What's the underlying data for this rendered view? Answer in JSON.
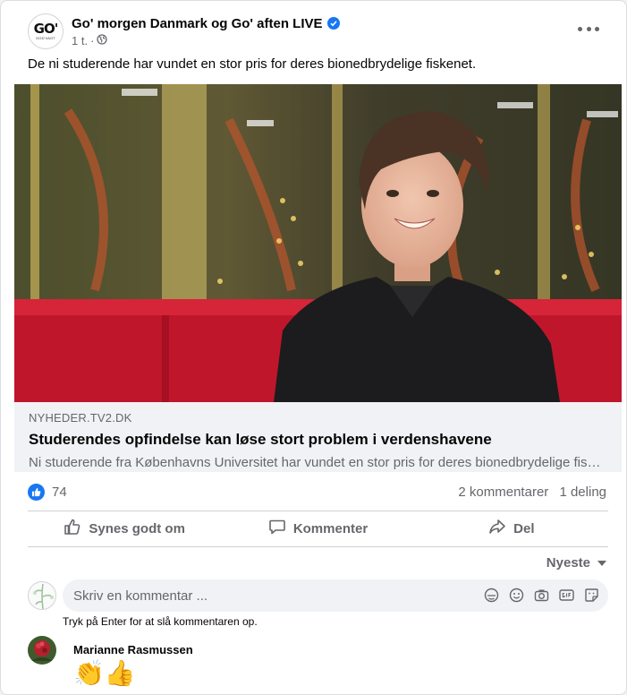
{
  "post": {
    "page_name": "Go' morgen Danmark og Go' aften LIVE",
    "logo_text": "GO'",
    "logo_subtext": "GOD'VAGT",
    "time": "1 t.",
    "separator": "·",
    "text": "De ni studerende har vundet en stor pris for deres bionedbrydelige fiskenet.",
    "more_icon": "ellipsis-icon",
    "privacy_icon": "globe-icon",
    "verified_icon": "verified-badge-icon"
  },
  "link_preview": {
    "domain": "NYHEDER.TV2.DK",
    "title": "Studerendes opfindelse kan løse stort problem i verdenshavene",
    "description": "Ni studerende fra Københavns Universitet har vundet en stor pris for deres bionedbrydelige fiskenet."
  },
  "stats": {
    "reactions_count": "74",
    "comments": "2 kommentarer",
    "shares": "1 deling"
  },
  "actions": {
    "like": "Synes godt om",
    "comment": "Kommenter",
    "share": "Del"
  },
  "comments": {
    "sort_label": "Nyeste",
    "placeholder": "Skriv en kommentar ...",
    "hint": "Tryk på Enter for at slå kommentaren op.",
    "items": [
      {
        "author": "Marianne Rasmussen",
        "content": "👏👍"
      }
    ]
  },
  "colors": {
    "accent": "#1877f2",
    "secondary_text": "#65676b",
    "link_bg": "#f0f2f5"
  }
}
